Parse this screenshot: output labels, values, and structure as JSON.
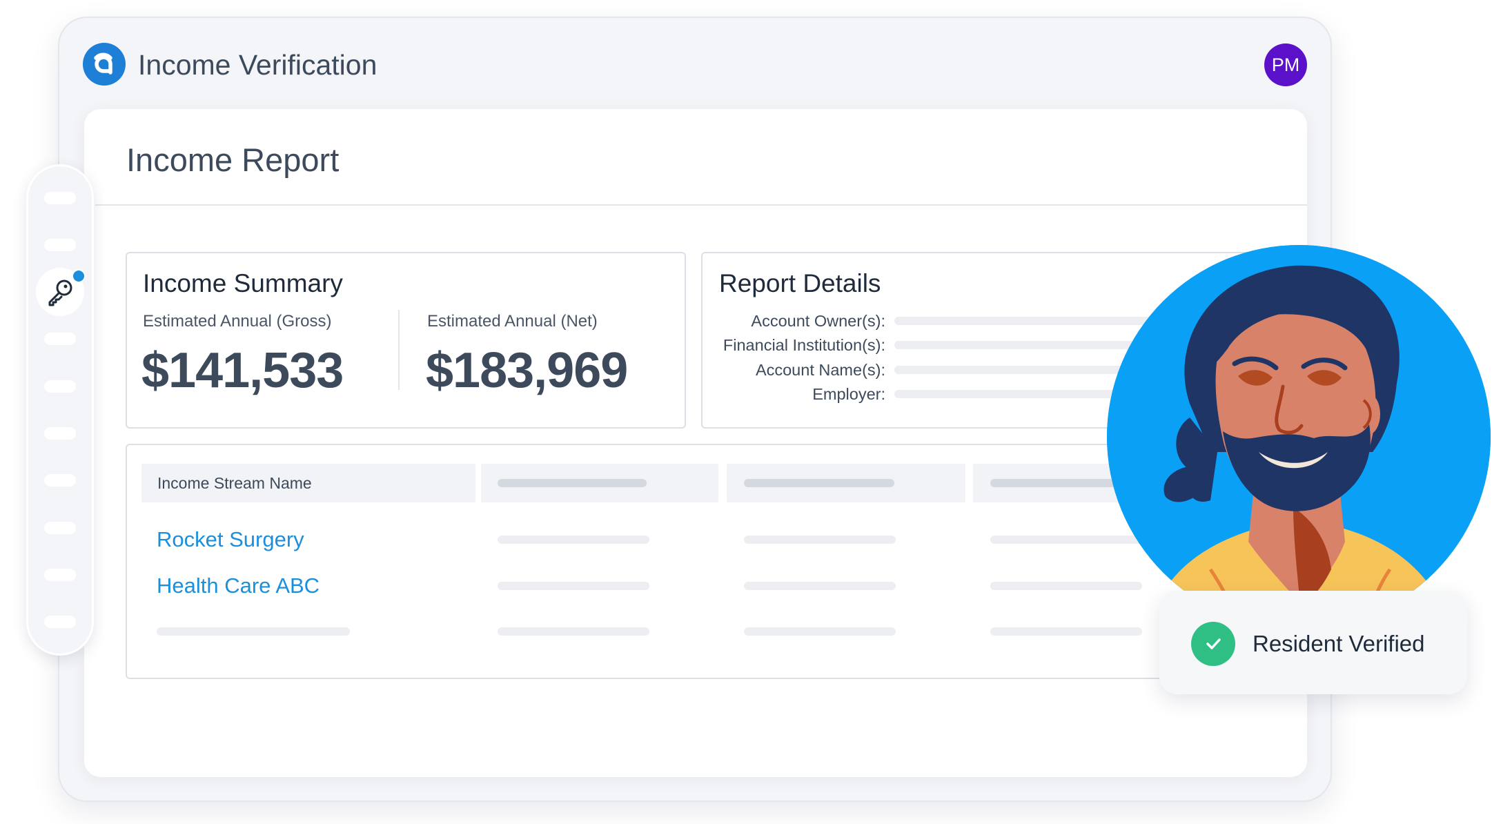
{
  "app": {
    "title": "Income Verification",
    "user_initials": "PM"
  },
  "report": {
    "title": "Income Report"
  },
  "income_summary": {
    "title": "Income Summary",
    "gross_label": "Estimated Annual (Gross)",
    "gross_value": "$141,533",
    "net_label": "Estimated Annual (Net)",
    "net_value": "$183,969"
  },
  "report_details": {
    "title": "Report Details",
    "fields": [
      "Account Owner(s):",
      "Financial Institution(s):",
      "Account Name(s):",
      "Employer:"
    ]
  },
  "income_streams": {
    "header": "Income Stream Name",
    "rows": [
      "Rocket Surgery",
      "Health Care ABC"
    ]
  },
  "status": {
    "label": "Resident Verified"
  },
  "colors": {
    "brand_blue": "#1d7fd6",
    "link_blue": "#1c8fdc",
    "avatar_purple": "#5b10c9",
    "success_green": "#2fbf85"
  },
  "icons": {
    "logo": "brand-a-logo",
    "sidebar_active": "key-icon",
    "status": "check-icon"
  }
}
